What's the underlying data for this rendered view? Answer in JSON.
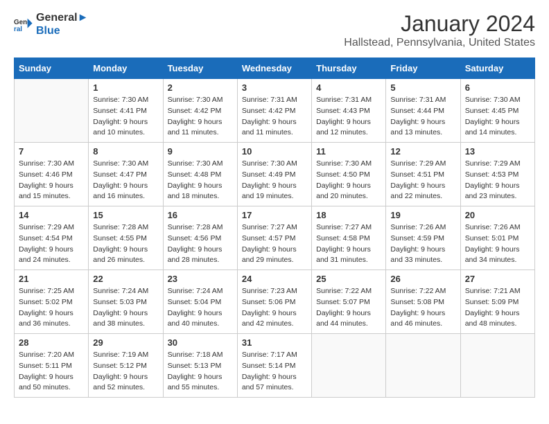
{
  "header": {
    "logo_line1": "General",
    "logo_line2": "Blue",
    "title": "January 2024",
    "subtitle": "Hallstead, Pennsylvania, United States"
  },
  "days_of_week": [
    "Sunday",
    "Monday",
    "Tuesday",
    "Wednesday",
    "Thursday",
    "Friday",
    "Saturday"
  ],
  "weeks": [
    [
      {
        "day": "",
        "sunrise": "",
        "sunset": "",
        "daylight": ""
      },
      {
        "day": "1",
        "sunrise": "Sunrise: 7:30 AM",
        "sunset": "Sunset: 4:41 PM",
        "daylight": "Daylight: 9 hours and 10 minutes."
      },
      {
        "day": "2",
        "sunrise": "Sunrise: 7:30 AM",
        "sunset": "Sunset: 4:42 PM",
        "daylight": "Daylight: 9 hours and 11 minutes."
      },
      {
        "day": "3",
        "sunrise": "Sunrise: 7:31 AM",
        "sunset": "Sunset: 4:42 PM",
        "daylight": "Daylight: 9 hours and 11 minutes."
      },
      {
        "day": "4",
        "sunrise": "Sunrise: 7:31 AM",
        "sunset": "Sunset: 4:43 PM",
        "daylight": "Daylight: 9 hours and 12 minutes."
      },
      {
        "day": "5",
        "sunrise": "Sunrise: 7:31 AM",
        "sunset": "Sunset: 4:44 PM",
        "daylight": "Daylight: 9 hours and 13 minutes."
      },
      {
        "day": "6",
        "sunrise": "Sunrise: 7:30 AM",
        "sunset": "Sunset: 4:45 PM",
        "daylight": "Daylight: 9 hours and 14 minutes."
      }
    ],
    [
      {
        "day": "7",
        "sunrise": "Sunrise: 7:30 AM",
        "sunset": "Sunset: 4:46 PM",
        "daylight": "Daylight: 9 hours and 15 minutes."
      },
      {
        "day": "8",
        "sunrise": "Sunrise: 7:30 AM",
        "sunset": "Sunset: 4:47 PM",
        "daylight": "Daylight: 9 hours and 16 minutes."
      },
      {
        "day": "9",
        "sunrise": "Sunrise: 7:30 AM",
        "sunset": "Sunset: 4:48 PM",
        "daylight": "Daylight: 9 hours and 18 minutes."
      },
      {
        "day": "10",
        "sunrise": "Sunrise: 7:30 AM",
        "sunset": "Sunset: 4:49 PM",
        "daylight": "Daylight: 9 hours and 19 minutes."
      },
      {
        "day": "11",
        "sunrise": "Sunrise: 7:30 AM",
        "sunset": "Sunset: 4:50 PM",
        "daylight": "Daylight: 9 hours and 20 minutes."
      },
      {
        "day": "12",
        "sunrise": "Sunrise: 7:29 AM",
        "sunset": "Sunset: 4:51 PM",
        "daylight": "Daylight: 9 hours and 22 minutes."
      },
      {
        "day": "13",
        "sunrise": "Sunrise: 7:29 AM",
        "sunset": "Sunset: 4:53 PM",
        "daylight": "Daylight: 9 hours and 23 minutes."
      }
    ],
    [
      {
        "day": "14",
        "sunrise": "Sunrise: 7:29 AM",
        "sunset": "Sunset: 4:54 PM",
        "daylight": "Daylight: 9 hours and 24 minutes."
      },
      {
        "day": "15",
        "sunrise": "Sunrise: 7:28 AM",
        "sunset": "Sunset: 4:55 PM",
        "daylight": "Daylight: 9 hours and 26 minutes."
      },
      {
        "day": "16",
        "sunrise": "Sunrise: 7:28 AM",
        "sunset": "Sunset: 4:56 PM",
        "daylight": "Daylight: 9 hours and 28 minutes."
      },
      {
        "day": "17",
        "sunrise": "Sunrise: 7:27 AM",
        "sunset": "Sunset: 4:57 PM",
        "daylight": "Daylight: 9 hours and 29 minutes."
      },
      {
        "day": "18",
        "sunrise": "Sunrise: 7:27 AM",
        "sunset": "Sunset: 4:58 PM",
        "daylight": "Daylight: 9 hours and 31 minutes."
      },
      {
        "day": "19",
        "sunrise": "Sunrise: 7:26 AM",
        "sunset": "Sunset: 4:59 PM",
        "daylight": "Daylight: 9 hours and 33 minutes."
      },
      {
        "day": "20",
        "sunrise": "Sunrise: 7:26 AM",
        "sunset": "Sunset: 5:01 PM",
        "daylight": "Daylight: 9 hours and 34 minutes."
      }
    ],
    [
      {
        "day": "21",
        "sunrise": "Sunrise: 7:25 AM",
        "sunset": "Sunset: 5:02 PM",
        "daylight": "Daylight: 9 hours and 36 minutes."
      },
      {
        "day": "22",
        "sunrise": "Sunrise: 7:24 AM",
        "sunset": "Sunset: 5:03 PM",
        "daylight": "Daylight: 9 hours and 38 minutes."
      },
      {
        "day": "23",
        "sunrise": "Sunrise: 7:24 AM",
        "sunset": "Sunset: 5:04 PM",
        "daylight": "Daylight: 9 hours and 40 minutes."
      },
      {
        "day": "24",
        "sunrise": "Sunrise: 7:23 AM",
        "sunset": "Sunset: 5:06 PM",
        "daylight": "Daylight: 9 hours and 42 minutes."
      },
      {
        "day": "25",
        "sunrise": "Sunrise: 7:22 AM",
        "sunset": "Sunset: 5:07 PM",
        "daylight": "Daylight: 9 hours and 44 minutes."
      },
      {
        "day": "26",
        "sunrise": "Sunrise: 7:22 AM",
        "sunset": "Sunset: 5:08 PM",
        "daylight": "Daylight: 9 hours and 46 minutes."
      },
      {
        "day": "27",
        "sunrise": "Sunrise: 7:21 AM",
        "sunset": "Sunset: 5:09 PM",
        "daylight": "Daylight: 9 hours and 48 minutes."
      }
    ],
    [
      {
        "day": "28",
        "sunrise": "Sunrise: 7:20 AM",
        "sunset": "Sunset: 5:11 PM",
        "daylight": "Daylight: 9 hours and 50 minutes."
      },
      {
        "day": "29",
        "sunrise": "Sunrise: 7:19 AM",
        "sunset": "Sunset: 5:12 PM",
        "daylight": "Daylight: 9 hours and 52 minutes."
      },
      {
        "day": "30",
        "sunrise": "Sunrise: 7:18 AM",
        "sunset": "Sunset: 5:13 PM",
        "daylight": "Daylight: 9 hours and 55 minutes."
      },
      {
        "day": "31",
        "sunrise": "Sunrise: 7:17 AM",
        "sunset": "Sunset: 5:14 PM",
        "daylight": "Daylight: 9 hours and 57 minutes."
      },
      {
        "day": "",
        "sunrise": "",
        "sunset": "",
        "daylight": ""
      },
      {
        "day": "",
        "sunrise": "",
        "sunset": "",
        "daylight": ""
      },
      {
        "day": "",
        "sunrise": "",
        "sunset": "",
        "daylight": ""
      }
    ]
  ]
}
